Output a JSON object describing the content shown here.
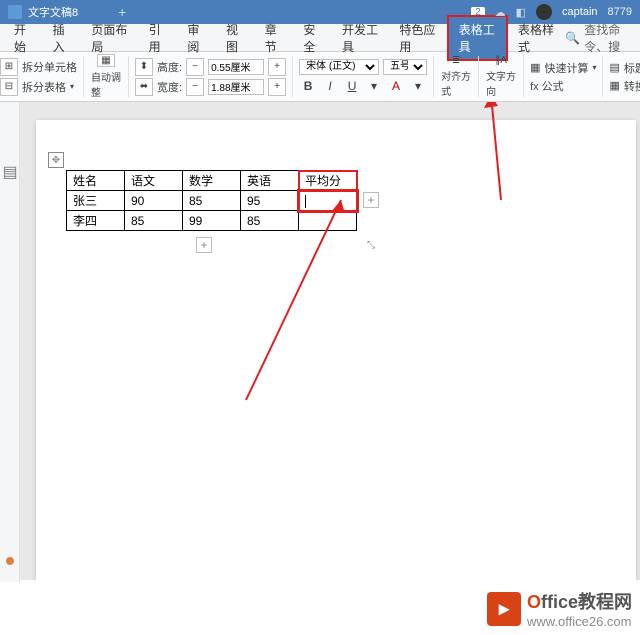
{
  "titlebar": {
    "doc_name": "文字文稿8",
    "badge": "2",
    "user": "captain",
    "count": "8779"
  },
  "menu": {
    "items": [
      "开始",
      "插入",
      "页面布局",
      "引用",
      "审阅",
      "视图",
      "章节",
      "安全",
      "开发工具",
      "特色应用",
      "表格工具",
      "表格样式"
    ],
    "active_index": 10,
    "search_placeholder": "查找命令、搜"
  },
  "ribbon": {
    "split_cell": "拆分单元格",
    "split_table": "拆分表格",
    "auto_adjust": "自动调整",
    "height_label": "高度:",
    "height_value": "0.55厘米",
    "width_label": "宽度:",
    "width_value": "1.88厘米",
    "font_name": "宋体 (正文)",
    "font_size": "五号",
    "align": "对齐方式",
    "text_dir": "文字方向",
    "formula": "fx 公式",
    "quick_calc": "快速计算",
    "title_row": "标题",
    "convert": "转换"
  },
  "table": {
    "headers": [
      "姓名",
      "语文",
      "数学",
      "英语",
      "平均分"
    ],
    "rows": [
      [
        "张三",
        "90",
        "85",
        "95",
        ""
      ],
      [
        "李四",
        "85",
        "99",
        "85",
        ""
      ]
    ]
  },
  "watermark": {
    "title_prefix": "O",
    "title_rest": "ffice教程网",
    "url": "www.office26.com"
  }
}
